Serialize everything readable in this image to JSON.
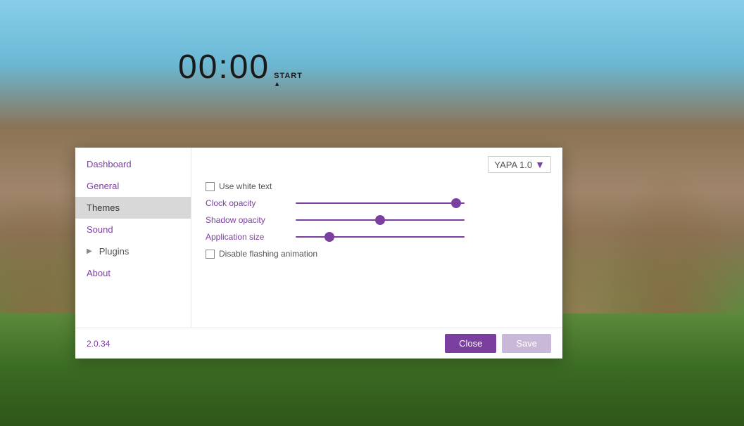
{
  "background": {
    "description": "Mountain landscape with blue sky"
  },
  "clock": {
    "time": "00:00",
    "start_label": "START",
    "start_sub": "▲"
  },
  "modal": {
    "sidebar": {
      "items": [
        {
          "id": "dashboard",
          "label": "Dashboard",
          "active": false,
          "has_arrow": false
        },
        {
          "id": "general",
          "label": "General",
          "active": false,
          "has_arrow": false
        },
        {
          "id": "themes",
          "label": "Themes",
          "active": true,
          "has_arrow": false
        },
        {
          "id": "sound",
          "label": "Sound",
          "active": false,
          "has_arrow": false
        },
        {
          "id": "plugins",
          "label": "Plugins",
          "active": false,
          "has_arrow": true
        },
        {
          "id": "about",
          "label": "About",
          "active": false,
          "has_arrow": false
        }
      ]
    },
    "content": {
      "theme_dropdown": {
        "value": "YAPA 1.0",
        "arrow": "▼"
      },
      "use_white_text": {
        "label": "Use white text",
        "checked": false
      },
      "clock_opacity": {
        "label": "Clock opacity",
        "value": 95
      },
      "shadow_opacity": {
        "label": "Shadow opacity",
        "value": 50
      },
      "application_size": {
        "label": "Application size",
        "value": 30
      },
      "disable_flashing": {
        "label": "Disable flashing animation",
        "checked": false
      }
    },
    "footer": {
      "version": "2.0.34",
      "close_button": "Close",
      "save_button": "Save"
    }
  }
}
